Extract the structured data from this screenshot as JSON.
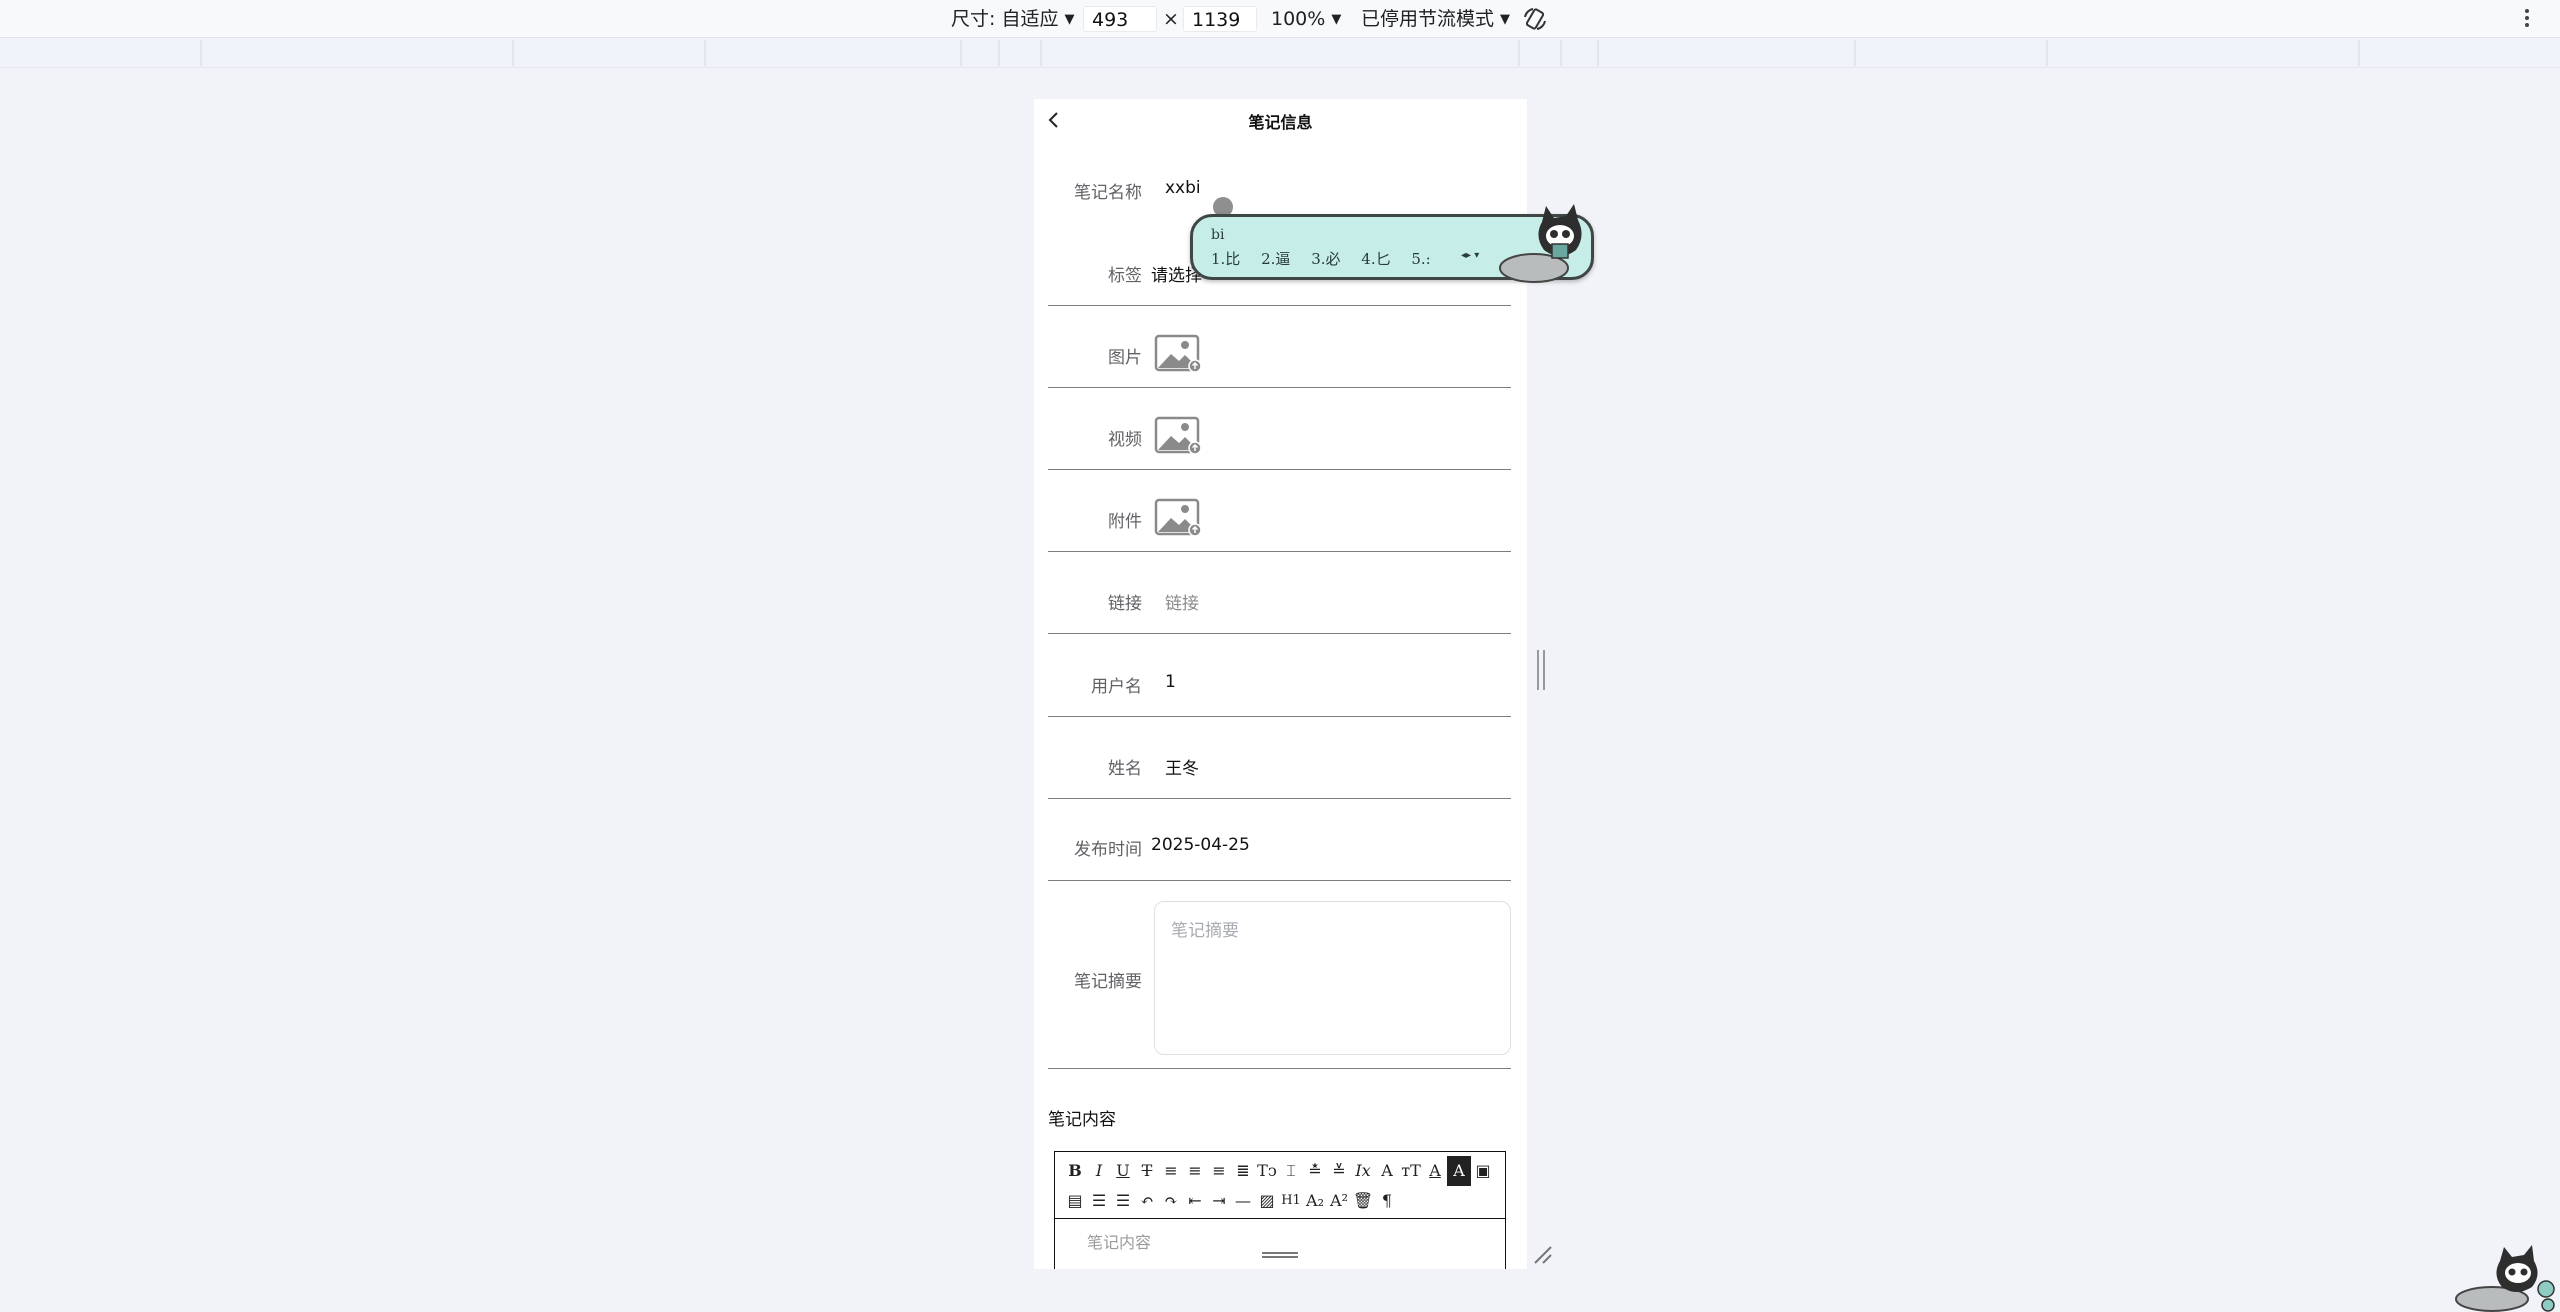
{
  "devtools": {
    "size_label": "尺寸: 自适应",
    "width": "493",
    "times": "×",
    "height": "1139",
    "zoom": "100%",
    "throttle": "已停用节流模式"
  },
  "page": {
    "title": "笔记信息",
    "fields": {
      "name": {
        "label": "笔记名称",
        "value": "xxbi"
      },
      "tag": {
        "label": "标签",
        "placeholder": "请选择"
      },
      "image": {
        "label": "图片"
      },
      "video": {
        "label": "视频"
      },
      "attachment": {
        "label": "附件"
      },
      "link": {
        "label": "链接",
        "placeholder": "链接"
      },
      "username": {
        "label": "用户名",
        "value": "1"
      },
      "realname": {
        "label": "姓名",
        "value": "王冬"
      },
      "publish_time": {
        "label": "发布时间",
        "value": "2025-04-25"
      },
      "summary": {
        "label": "笔记摘要",
        "placeholder": "笔记摘要"
      }
    },
    "content_label": "笔记内容",
    "editor_placeholder": "笔记内容"
  },
  "ime": {
    "composition": "bi",
    "candidates": [
      "1.比",
      "2.逼",
      "3.必",
      "4.匕",
      "5.:"
    ]
  },
  "icons": {
    "back": "chevron-left-icon",
    "upload": "image-upload-icon",
    "rotate": "rotate-device-icon",
    "more": "kebab-menu-icon"
  }
}
